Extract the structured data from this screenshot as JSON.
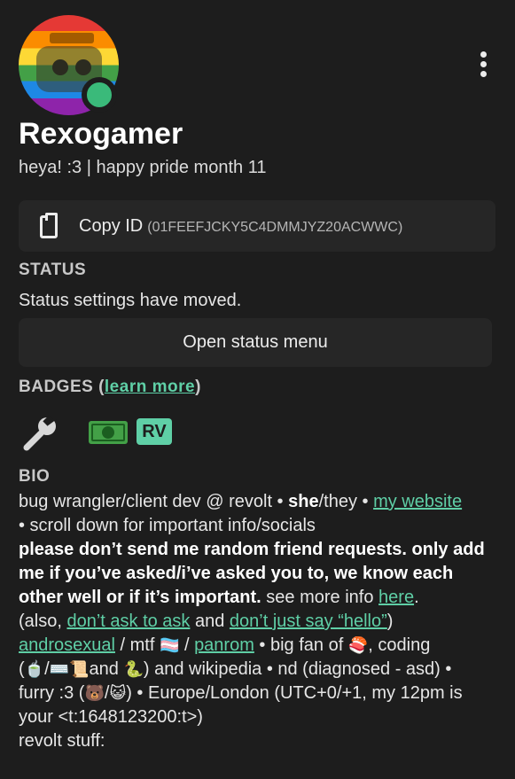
{
  "profile": {
    "username": "Rexogamer",
    "custom_status": "heya! :3 | happy pride month 11",
    "presence_color": "#3aba7a"
  },
  "copy_id": {
    "label": "Copy ID",
    "id_text": "(01FEEFJCKY5C4DMMJYZ20ACWWC)",
    "icon": "clipboard-icon"
  },
  "status": {
    "heading": "STATUS",
    "message": "Status settings have moved.",
    "button_label": "Open status menu"
  },
  "badges": {
    "heading": "BADGES (",
    "link": "learn more",
    "close": ")",
    "items": [
      "wrench-icon",
      "money-icon",
      "RV"
    ],
    "rv_label": "RV",
    "accent": "#5fcfa6"
  },
  "bio": {
    "heading": "BIO",
    "t1": "bug wrangler/client dev @ revolt • ",
    "she": "she",
    "t2": "/they • ",
    "link_website": "my website",
    "t3": "• scroll down for important info/socials",
    "bold1": "please don’t send me random friend requests. only add me if you’ve asked/i’ve asked you to, we know each other well or if it’s important.",
    "t4": " see more info ",
    "link_here": "here",
    "t5": ".",
    "t6": "(also, ",
    "link_dont_ask": "don’t ask to ask",
    "t7": " and ",
    "link_hello": "don’t just say “hello”",
    "t8": ")",
    "link_andro": "androsexual",
    "t9": " / mtf ",
    "flag": "🏳️‍⚧️",
    "t10": " / ",
    "link_panrom": "panrom",
    "t11": " • big fan of ",
    "sushi": "🍣",
    "t12": ", coding",
    "t13": "(",
    "tea": "🍵",
    "t14": "/",
    "kbd": "⌨️",
    "scroll": "📜",
    "t15": "and ",
    "snake": "🐍",
    "t16": ") and wikipedia • nd (diagnosed - asd) •",
    "t17": "furry :3 (",
    "bear": "🐻",
    "t18": "/",
    "cat": "😺",
    "t19": ") • Europe/London (UTC+0/+1, my 12pm is",
    "t20": "your <t:1648123200:t>)",
    "t21": "revolt stuff:"
  }
}
